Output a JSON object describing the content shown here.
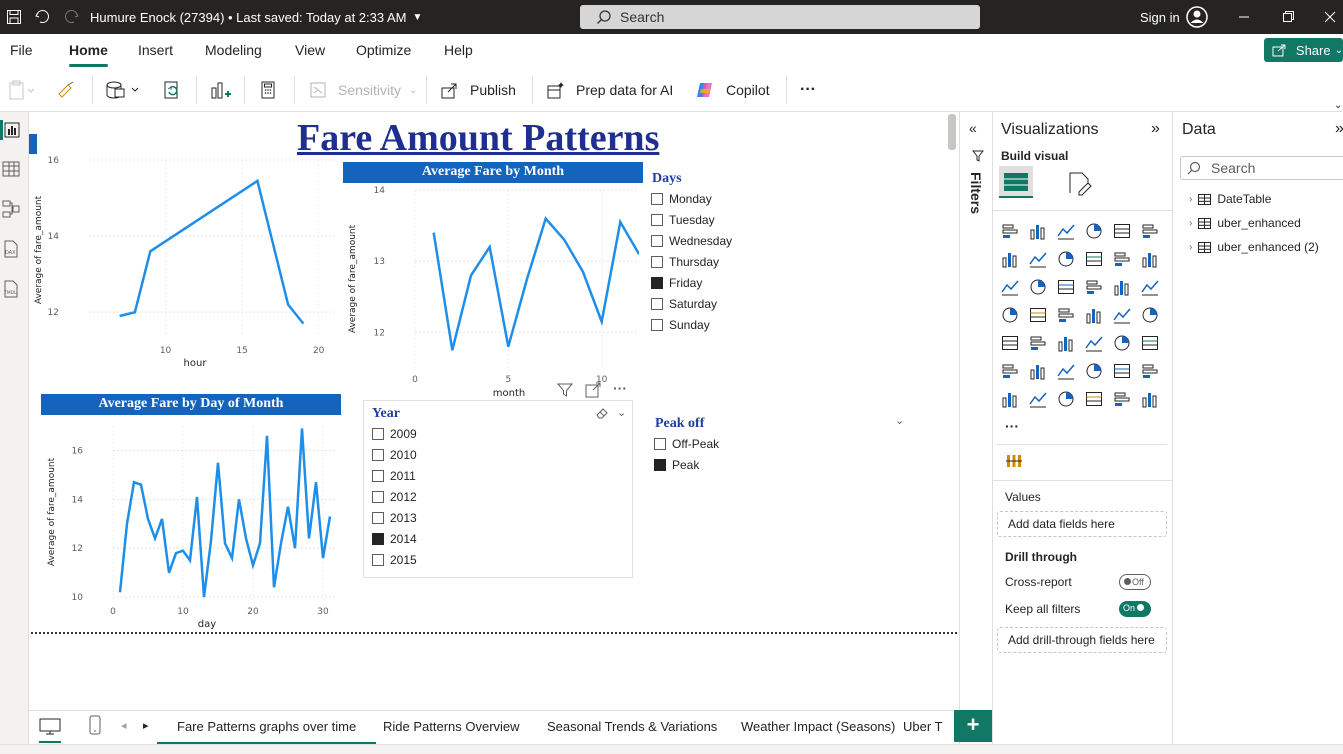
{
  "titlebar": {
    "doc_title": "Humure Enock (27394) • Last saved: Today at 2:33 AM",
    "search_placeholder": "Search",
    "sign_in": "Sign in"
  },
  "menu": {
    "items": [
      "File",
      "Home",
      "Insert",
      "Modeling",
      "View",
      "Optimize",
      "Help"
    ],
    "active": "Home",
    "share_label": "Share"
  },
  "ribbon": {
    "sensitivity": "Sensitivity",
    "publish": "Publish",
    "prep_data": "Prep data for AI",
    "copilot": "Copilot",
    "more": "···"
  },
  "report": {
    "title": "Fare Amount Patterns",
    "hour_chart": {
      "xlabel": "hour",
      "ylabel": "Average of fare_amount"
    },
    "month_chart": {
      "title": "Average Fare by Month",
      "xlabel": "month",
      "ylabel": "Average of fare_amount"
    },
    "day_chart": {
      "title": "Average Fare by Day of Month",
      "xlabel": "day",
      "ylabel": "Average of fare_amount"
    },
    "days_slicer": {
      "title": "Days",
      "items": [
        {
          "label": "Monday",
          "checked": false
        },
        {
          "label": "Tuesday",
          "checked": false
        },
        {
          "label": "Wednesday",
          "checked": false
        },
        {
          "label": "Thursday",
          "checked": false
        },
        {
          "label": "Friday",
          "checked": true
        },
        {
          "label": "Saturday",
          "checked": false
        },
        {
          "label": "Sunday",
          "checked": false
        }
      ]
    },
    "year_slicer": {
      "title": "Year",
      "items": [
        {
          "label": "2009",
          "checked": false
        },
        {
          "label": "2010",
          "checked": false
        },
        {
          "label": "2011",
          "checked": false
        },
        {
          "label": "2012",
          "checked": false
        },
        {
          "label": "2013",
          "checked": false
        },
        {
          "label": "2014",
          "checked": true
        },
        {
          "label": "2015",
          "checked": false
        }
      ]
    },
    "peak_slicer": {
      "title": "Peak off",
      "items": [
        {
          "label": "Off-Peak",
          "checked": false
        },
        {
          "label": "Peak",
          "checked": true
        }
      ]
    }
  },
  "chart_data": [
    {
      "type": "line",
      "title": "",
      "xlabel": "hour",
      "ylabel": "Average of fare_amount",
      "x": [
        7,
        8,
        9,
        16,
        18,
        19
      ],
      "y": [
        11.9,
        12.0,
        13.6,
        15.45,
        12.2,
        11.7
      ],
      "xlim": [
        5,
        21
      ],
      "ylim": [
        11.4,
        16
      ],
      "xticks": [
        10,
        15,
        20
      ],
      "yticks": [
        12,
        14,
        16
      ],
      "grid": true,
      "color": "#1e8ee8"
    },
    {
      "type": "line",
      "title": "Average Fare by Month",
      "xlabel": "month",
      "ylabel": "Average of fare_amount",
      "x": [
        1,
        2,
        3,
        4,
        5,
        6,
        7,
        8,
        9,
        10,
        11,
        12
      ],
      "y": [
        13.4,
        11.75,
        12.8,
        13.2,
        11.8,
        12.75,
        13.6,
        13.3,
        12.85,
        12.15,
        13.55,
        13.1
      ],
      "xlim": [
        0,
        12
      ],
      "ylim": [
        11.5,
        14
      ],
      "xticks": [
        0,
        5,
        10
      ],
      "yticks": [
        12,
        13,
        14
      ],
      "grid": true,
      "color": "#1e8ee8"
    },
    {
      "type": "line",
      "title": "Average Fare by Day of Month",
      "xlabel": "day",
      "ylabel": "Average of fare_amount",
      "x": [
        1,
        2,
        3,
        4,
        5,
        6,
        7,
        8,
        9,
        10,
        11,
        12,
        13,
        14,
        15,
        16,
        17,
        18,
        19,
        20,
        21,
        22,
        23,
        24,
        25,
        26,
        27,
        28,
        29,
        30,
        31
      ],
      "y": [
        10.2,
        13.0,
        14.7,
        14.6,
        13.2,
        12.4,
        13.2,
        11.0,
        11.8,
        11.9,
        11.5,
        14.1,
        10.0,
        12.3,
        15.5,
        12.2,
        11.6,
        14.0,
        12.4,
        11.3,
        12.2,
        16.6,
        10.4,
        12.2,
        13.7,
        12.0,
        16.9,
        12.4,
        14.7,
        11.6,
        13.3
      ],
      "xlim": [
        0,
        32
      ],
      "ylim": [
        9.8,
        17
      ],
      "xticks": [
        0,
        10,
        20,
        30
      ],
      "yticks": [
        10,
        12,
        14,
        16
      ],
      "grid": true,
      "color": "#1e8ee8"
    }
  ],
  "filters": {
    "label": "Filters"
  },
  "visualizations": {
    "title": "Visualizations",
    "build_visual": "Build visual",
    "values_label": "Values",
    "add_data_fields": "Add data fields here",
    "drill_through": "Drill through",
    "cross_report": "Cross-report",
    "cross_report_state": "Off",
    "keep_all_filters": "Keep all filters",
    "keep_all_filters_state": "On",
    "add_drill_fields": "Add drill-through fields here",
    "more": "···"
  },
  "data_pane": {
    "title": "Data",
    "search_placeholder": "Search",
    "tables": [
      "DateTable",
      "uber_enhanced",
      "uber_enhanced (2)"
    ]
  },
  "pages": {
    "tabs": [
      "Fare Patterns graphs over time",
      "Ride Patterns Overview",
      "Seasonal Trends & Variations",
      "Weather Impact (Seasons)",
      "Uber T"
    ],
    "active": 0,
    "add_label": "+"
  },
  "colors": {
    "accent": "#117865",
    "header_blue": "#1464be",
    "title_blue": "#1f2f8f",
    "line_blue": "#1e8ee8"
  }
}
